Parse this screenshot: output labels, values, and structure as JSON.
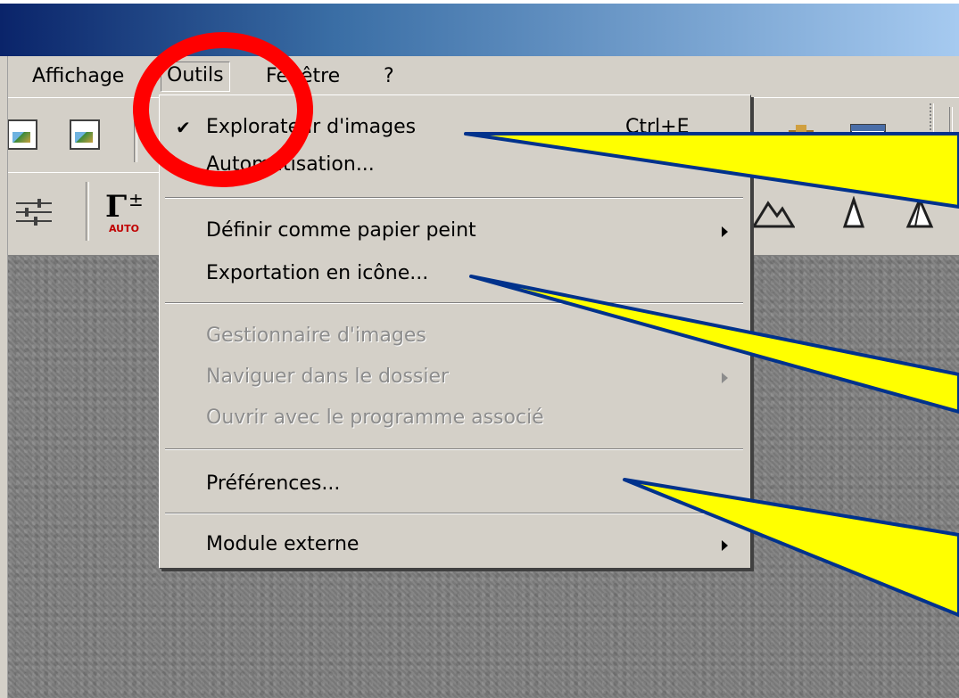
{
  "menubar": {
    "items": [
      {
        "label": "Affichage"
      },
      {
        "label": "Outils"
      },
      {
        "label": "Fenêtre"
      },
      {
        "label": "?"
      }
    ]
  },
  "toolbar2": {
    "gamma_label": "Γ",
    "gamma_sign": "±",
    "gamma_auto": "AUTO"
  },
  "tools_menu": {
    "items": [
      {
        "label": "Explorateur d'images",
        "shortcut": "Ctrl+E",
        "checked": true
      },
      {
        "label": "Automatisation..."
      },
      {
        "label": "Définir comme papier peint",
        "submenu": true
      },
      {
        "label": "Exportation en icône..."
      },
      {
        "label": "Gestionnaire d'images",
        "disabled": true
      },
      {
        "label": "Naviguer dans le dossier",
        "disabled": true,
        "submenu": true
      },
      {
        "label": "Ouvrir avec le programme associé",
        "disabled": true
      },
      {
        "label": "Préférences..."
      },
      {
        "label": "Module externe",
        "submenu": true
      }
    ],
    "check_glyph": "✔"
  },
  "annotations": {
    "circle_color": "#ff0000",
    "callout_fill": "#ffff00",
    "callout_stroke": "#00328c"
  }
}
